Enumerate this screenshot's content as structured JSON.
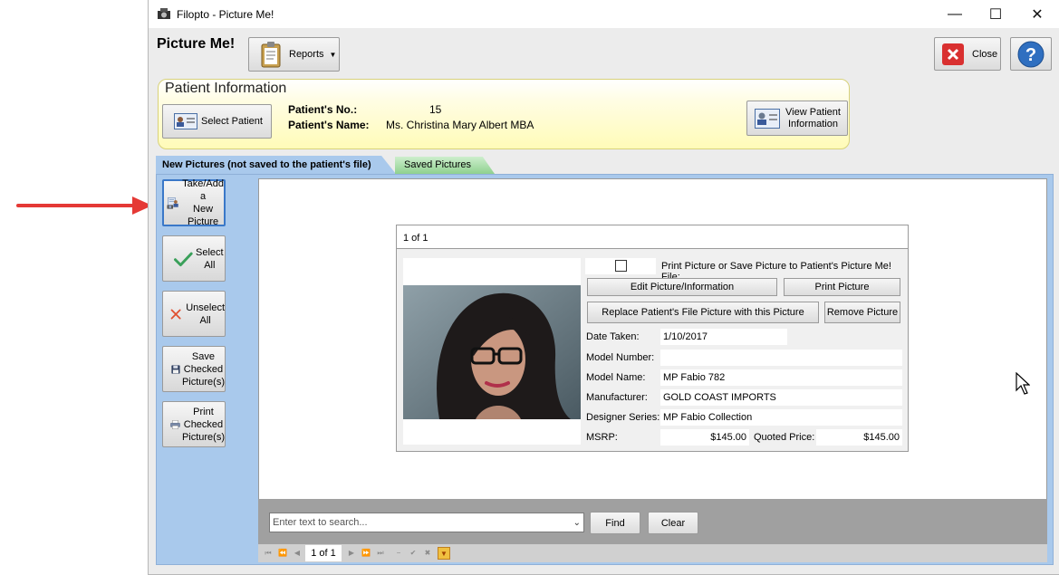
{
  "window": {
    "title": "Filopto - Picture Me!",
    "minimize_glyph": "—",
    "maximize_glyph": "☐",
    "close_glyph": "✕"
  },
  "toolbar": {
    "page_title": "Picture Me!",
    "reports_label": "Reports",
    "close_label": "Close",
    "help_icon": "help-icon"
  },
  "patient": {
    "panel_title": "Patient Information",
    "select_patient_label": "Select Patient",
    "number_label": "Patient's No.:",
    "number_value": "15",
    "name_label": "Patient's Name:",
    "name_value": "Ms. Christina Mary Albert MBA",
    "view_patient_line1": "View Patient",
    "view_patient_line2": "Information"
  },
  "tabs": [
    {
      "label": "New Pictures (not saved to the patient's file)",
      "active": true
    },
    {
      "label": "Saved Pictures",
      "active": false
    }
  ],
  "side_buttons": {
    "take_add_line1": "Take/Add a",
    "take_add_line2": "New Picture",
    "select_all": "Select All",
    "unselect_all": "Unselect All",
    "save_line1": "Save",
    "save_line2": "Checked",
    "save_line3": "Picture(s)",
    "print_line1": "Print",
    "print_line2": "Checked",
    "print_line3": "Picture(s)"
  },
  "card": {
    "count": "1 of 1",
    "print_save_label": "Print Picture or Save Picture to Patient's Picture Me! File:",
    "print_save_checked": false,
    "edit_button": "Edit Picture/Information",
    "print_button": "Print Picture",
    "replace_button": "Replace Patient's File Picture with this Picture",
    "remove_button": "Remove Picture",
    "fields": {
      "date_taken_label": "Date Taken:",
      "date_taken": "1/10/2017",
      "model_number_label": "Model Number:",
      "model_number": "",
      "model_name_label": "Model Name:",
      "model_name": "MP Fabio 782",
      "manufacturer_label": "Manufacturer:",
      "manufacturer": "GOLD COAST IMPORTS",
      "designer_series_label": "Designer Series:",
      "designer_series": "MP Fabio Collection",
      "msrp_label": "MSRP:",
      "msrp": "$145.00",
      "quoted_price_label": "Quoted Price:",
      "quoted_price": "$145.00"
    }
  },
  "search": {
    "placeholder": "Enter text to search...",
    "find_label": "Find",
    "clear_label": "Clear"
  },
  "navigator": {
    "count": "1 of 1"
  },
  "colors": {
    "annotation_arrow": "#e53935",
    "active_tab": "#a9c9ec",
    "saved_tab": "#8fd18f",
    "patient_panel": "#fffbb8"
  }
}
